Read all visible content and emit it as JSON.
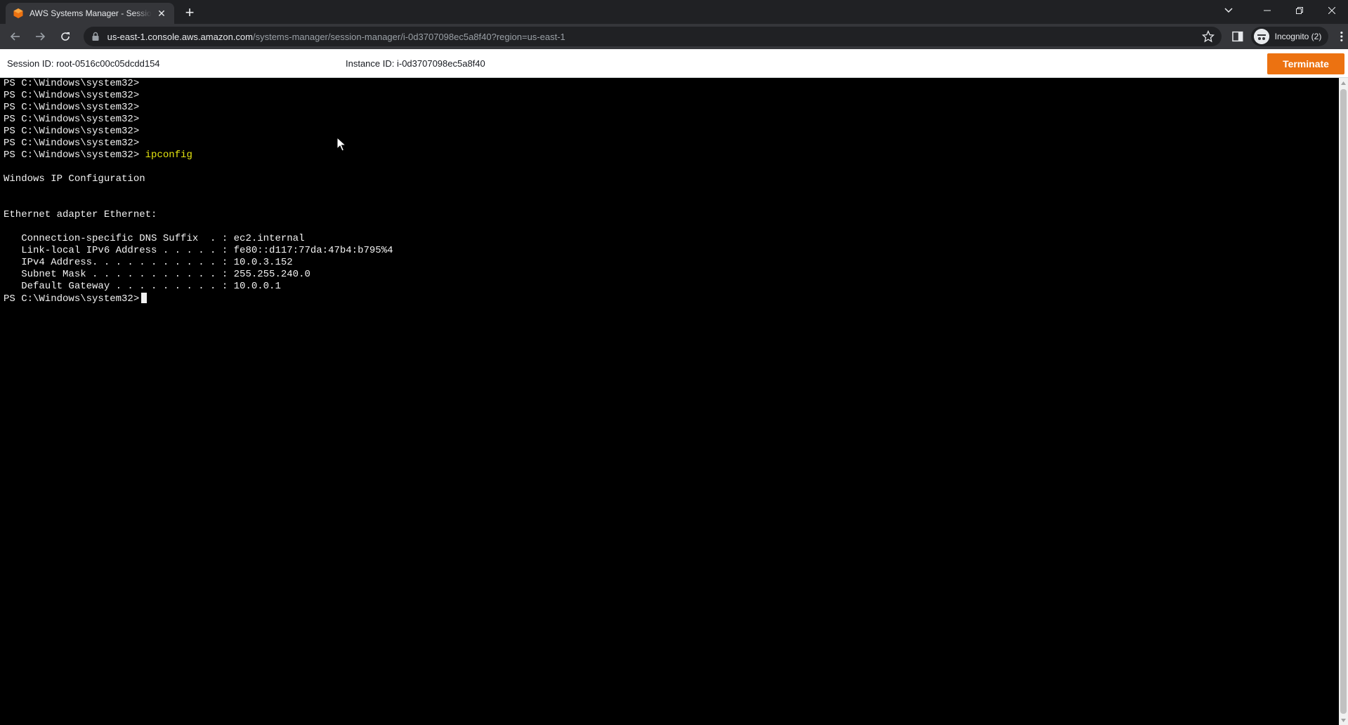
{
  "browser": {
    "tab": {
      "title": "AWS Systems Manager - Session Manager"
    },
    "url": {
      "host": "us-east-1.console.aws.amazon.com",
      "path": "/systems-manager/session-manager/i-0d3707098ec5a8f40?region=us-east-1"
    },
    "profile": {
      "label": "Incognito (2)"
    }
  },
  "session": {
    "session_id_label": "Session ID: root-0516c00c05dcdd154",
    "instance_id_label": "Instance ID: i-0d3707098ec5a8f40",
    "terminate_label": "Terminate"
  },
  "terminal": {
    "lines": [
      {
        "text": "PS C:\\Windows\\system32>",
        "cmd": ""
      },
      {
        "text": "PS C:\\Windows\\system32>",
        "cmd": ""
      },
      {
        "text": "PS C:\\Windows\\system32>",
        "cmd": ""
      },
      {
        "text": "PS C:\\Windows\\system32>",
        "cmd": ""
      },
      {
        "text": "PS C:\\Windows\\system32>",
        "cmd": ""
      },
      {
        "text": "PS C:\\Windows\\system32>",
        "cmd": ""
      },
      {
        "text": "PS C:\\Windows\\system32> ",
        "cmd": "ipconfig"
      },
      {
        "text": "",
        "cmd": ""
      },
      {
        "text": "Windows IP Configuration",
        "cmd": ""
      },
      {
        "text": "",
        "cmd": ""
      },
      {
        "text": "",
        "cmd": ""
      },
      {
        "text": "Ethernet adapter Ethernet:",
        "cmd": ""
      },
      {
        "text": "",
        "cmd": ""
      },
      {
        "text": "   Connection-specific DNS Suffix  . : ec2.internal",
        "cmd": ""
      },
      {
        "text": "   Link-local IPv6 Address . . . . . : fe80::d117:77da:47b4:b795%4",
        "cmd": ""
      },
      {
        "text": "   IPv4 Address. . . . . . . . . . . : 10.0.3.152",
        "cmd": ""
      },
      {
        "text": "   Subnet Mask . . . . . . . . . . . : 255.255.240.0",
        "cmd": ""
      },
      {
        "text": "   Default Gateway . . . . . . . . . : 10.0.0.1",
        "cmd": ""
      }
    ],
    "prompt": "PS C:\\Windows\\system32>"
  },
  "colors": {
    "terminate": "#ec7211",
    "command": "#e5e510",
    "favicon": "#ec7211"
  },
  "icons": [
    "aws-favicon-icon",
    "close-icon",
    "plus-icon",
    "chevron-down-icon",
    "minimize-icon",
    "restore-icon",
    "window-close-icon",
    "back-icon",
    "forward-icon",
    "reload-icon",
    "lock-icon",
    "star-icon",
    "side-panel-icon",
    "incognito-icon",
    "kebab-menu-icon",
    "mouse-pointer-icon"
  ]
}
